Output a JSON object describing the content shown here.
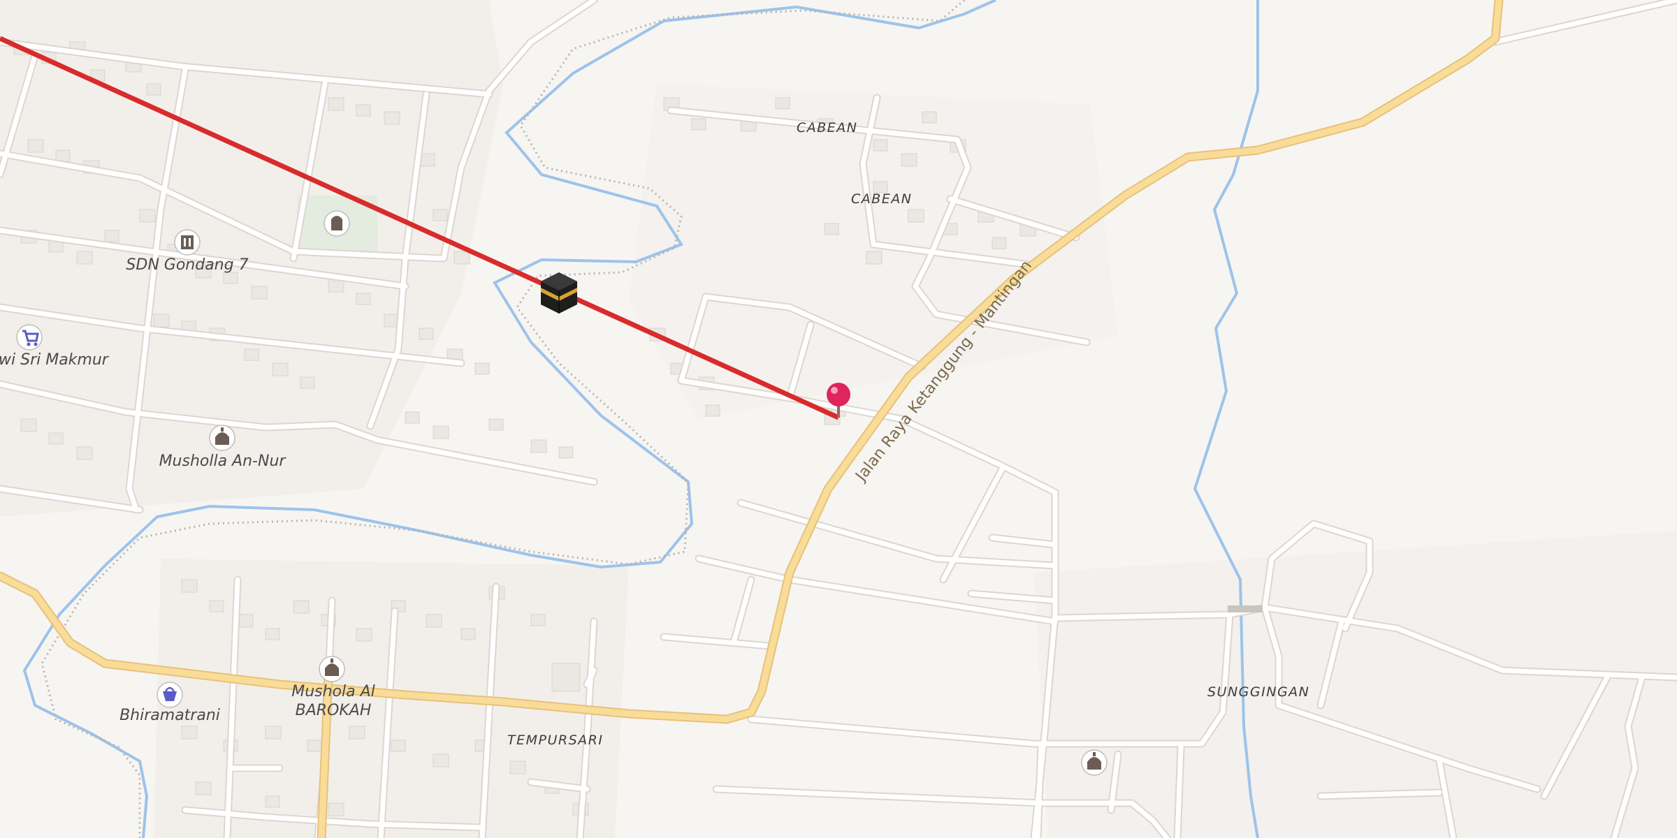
{
  "map": {
    "road_labels": {
      "main_road": "Jalan Raya Ketanggung - Mantingan"
    },
    "place_labels": {
      "cabean_1": "CABEAN",
      "cabean_2": "CABEAN",
      "tempursari": "TEMPURSARI",
      "sunggingan": "SUNGGINGAN"
    },
    "poi_labels": {
      "school": "SDN Gondang 7",
      "shop": "wi Sri Makmur",
      "musholla_an_nur": "Musholla An-Nur",
      "musholla_al_barokah_line1": "Mushola Al",
      "musholla_al_barokah_line2": "BAROKAH",
      "bhiramatrani": "Bhiramatrani"
    },
    "icons": {
      "school": "school-icon",
      "shop": "shopping-cart-icon",
      "mosque": "mosque-icon",
      "basket": "shopping-basket-icon",
      "cemetery": "cemetery-icon",
      "kaaba": "kaaba-icon",
      "pin": "location-pin-icon"
    },
    "colors": {
      "background": "#f7f5f2",
      "main_road": "#f9dc98",
      "minor_road": "#ffffff",
      "river": "#9cc3ea",
      "qibla_line": "#d92b2b",
      "pin": "#e0245e",
      "poi_icon": "#6b5d55",
      "shop_icon": "#5a5ac8"
    }
  }
}
